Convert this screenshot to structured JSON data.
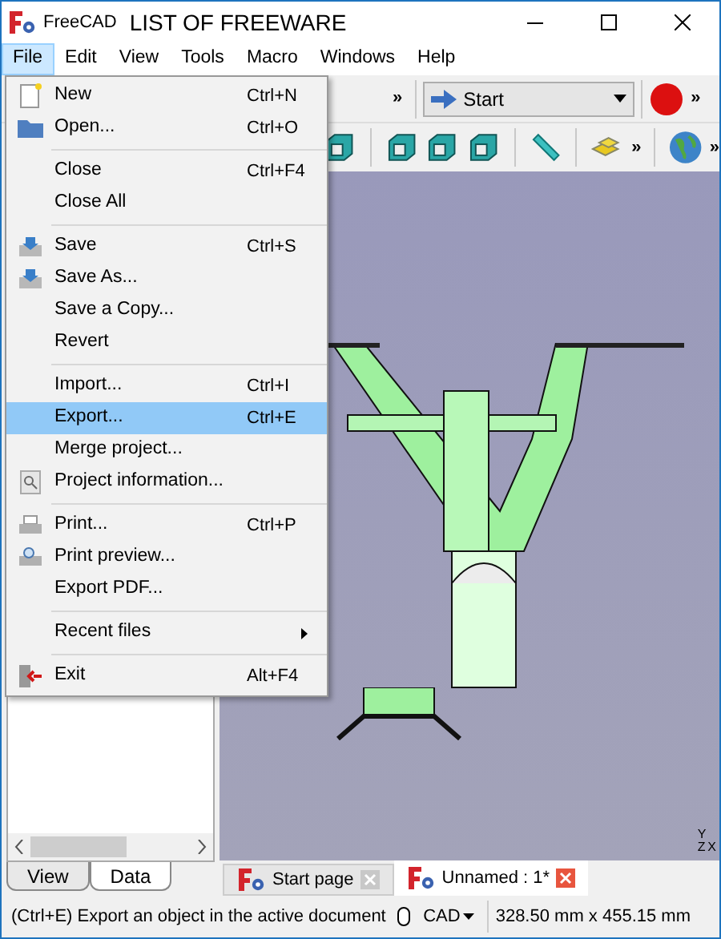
{
  "window": {
    "app_name": "FreeCAD",
    "title": "LIST OF FREEWARE"
  },
  "menubar": [
    {
      "label": "File",
      "selected": true
    },
    {
      "label": "Edit",
      "selected": false
    },
    {
      "label": "View",
      "selected": false
    },
    {
      "label": "Tools",
      "selected": false
    },
    {
      "label": "Macro",
      "selected": false
    },
    {
      "label": "Windows",
      "selected": false
    },
    {
      "label": "Help",
      "selected": false
    }
  ],
  "toolbar": {
    "workbench": "Start",
    "overflow": [
      "»",
      "»",
      "»",
      "»"
    ]
  },
  "file_menu": [
    [
      {
        "label": "New",
        "shortcut": "Ctrl+N",
        "kind": "new",
        "selected": false,
        "submenu": false
      },
      {
        "label": "Open...",
        "shortcut": "Ctrl+O",
        "kind": "open",
        "selected": false,
        "submenu": false
      }
    ],
    [
      {
        "label": "Close",
        "shortcut": "Ctrl+F4",
        "kind": "none",
        "selected": false,
        "submenu": false
      },
      {
        "label": "Close All",
        "kind": "none",
        "selected": false,
        "submenu": false
      }
    ],
    [
      {
        "label": "Save",
        "shortcut": "Ctrl+S",
        "kind": "save",
        "selected": false,
        "submenu": false
      },
      {
        "label": "Save As...",
        "kind": "save",
        "selected": false,
        "submenu": false
      },
      {
        "label": "Save a Copy...",
        "kind": "none",
        "selected": false,
        "submenu": false
      },
      {
        "label": "Revert",
        "kind": "none",
        "selected": false,
        "submenu": false
      }
    ],
    [
      {
        "label": "Import...",
        "shortcut": "Ctrl+I",
        "kind": "none",
        "selected": false,
        "submenu": false
      },
      {
        "label": "Export...",
        "shortcut": "Ctrl+E",
        "kind": "none",
        "selected": true,
        "submenu": false
      },
      {
        "label": "Merge project...",
        "kind": "none",
        "selected": false,
        "submenu": false
      },
      {
        "label": "Project information...",
        "kind": "info",
        "selected": false,
        "submenu": false
      }
    ],
    [
      {
        "label": "Print...",
        "shortcut": "Ctrl+P",
        "kind": "print",
        "selected": false,
        "submenu": false
      },
      {
        "label": "Print preview...",
        "kind": "preview",
        "selected": false,
        "submenu": false
      },
      {
        "label": "Export PDF...",
        "kind": "none",
        "selected": false,
        "submenu": false
      }
    ],
    [
      {
        "label": "Recent files",
        "kind": "none",
        "selected": false,
        "submenu": true
      }
    ],
    [
      {
        "label": "Exit",
        "shortcut": "Alt+F4",
        "kind": "exit",
        "selected": false,
        "submenu": false
      }
    ]
  ],
  "panel_tabs": [
    {
      "label": "View",
      "selected": false
    },
    {
      "label": "Data",
      "selected": true
    }
  ],
  "axes": {
    "y": "Y",
    "z": "Z",
    "x": "X"
  },
  "document_tabs": [
    {
      "label": "Start page",
      "selected": false
    },
    {
      "label": "Unnamed : 1*",
      "selected": true
    }
  ],
  "status_bar": {
    "message": "(Ctrl+E) Export an object in the active document",
    "navigation": "CAD",
    "dimensions": "328.50 mm x 455.15 mm"
  }
}
